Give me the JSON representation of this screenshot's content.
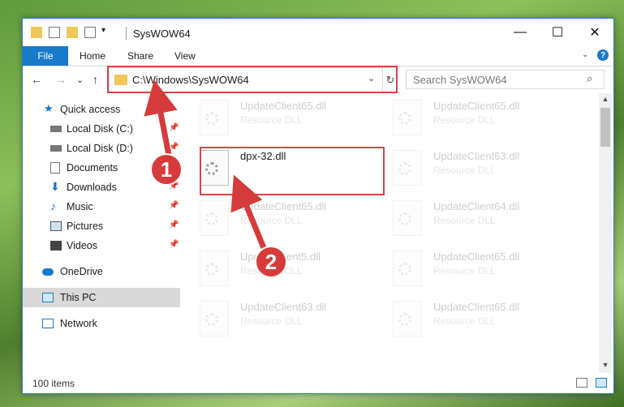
{
  "window": {
    "title": "SysWOW64",
    "controls": {
      "minimize": "—",
      "maximize": "☐",
      "close": "✕"
    }
  },
  "ribbon": {
    "tabs": [
      "File",
      "Home",
      "Share",
      "View"
    ],
    "help": "?"
  },
  "address_bar": {
    "path": "C:\\Windows\\SysWOW64",
    "dropdown": "⌄",
    "refresh": "↻"
  },
  "search": {
    "placeholder": "Search SysWOW64",
    "icon": "⌕"
  },
  "nav_buttons": {
    "back": "←",
    "forward": "→",
    "recent": "⌄",
    "up": "↑"
  },
  "nav_pane": {
    "quick_access": "Quick access",
    "items": [
      {
        "label": "Local Disk (C:)",
        "icon": "drive-icon",
        "pinned": true
      },
      {
        "label": "Local Disk (D:)",
        "icon": "drive-icon",
        "pinned": true
      },
      {
        "label": "Documents",
        "icon": "documents-icon",
        "pinned": true
      },
      {
        "label": "Downloads",
        "icon": "downloads-icon",
        "pinned": true
      },
      {
        "label": "Music",
        "icon": "music-icon",
        "pinned": true
      },
      {
        "label": "Pictures",
        "icon": "pictures-icon",
        "pinned": true
      },
      {
        "label": "Videos",
        "icon": "videos-icon",
        "pinned": true
      }
    ],
    "onedrive": "OneDrive",
    "this_pc": "This PC",
    "network": "Network"
  },
  "files": {
    "highlighted": {
      "name": "dpx-32.dll"
    },
    "left_column": [
      {
        "name": "UpdateClient65.dll",
        "type": "Resource DLL"
      },
      {
        "name": "UpdateClient65.dll",
        "type": "Resource DLL"
      },
      {
        "name": "UpdateClient5.dll",
        "type": "Resource DLL"
      },
      {
        "name": "UpdateClient63.dll",
        "type": "Resource DLL"
      }
    ],
    "right_column": [
      {
        "name": "UpdateClient65.dll",
        "type": "Resource DLL"
      },
      {
        "name": "UpdateClient63.dll",
        "type": "Resource DLL"
      },
      {
        "name": "UpdateClient64.dll",
        "type": "Resource DLL"
      },
      {
        "name": "UpdateClient65.dll",
        "type": "Resource DLL"
      },
      {
        "name": "UpdateClient65.dll",
        "type": "Resource DLL"
      }
    ]
  },
  "status": {
    "item_count": "100 items"
  },
  "annotations": {
    "step1": "1",
    "step2": "2"
  },
  "colors": {
    "accent": "#1979ca",
    "annotation": "#d63b3b"
  }
}
